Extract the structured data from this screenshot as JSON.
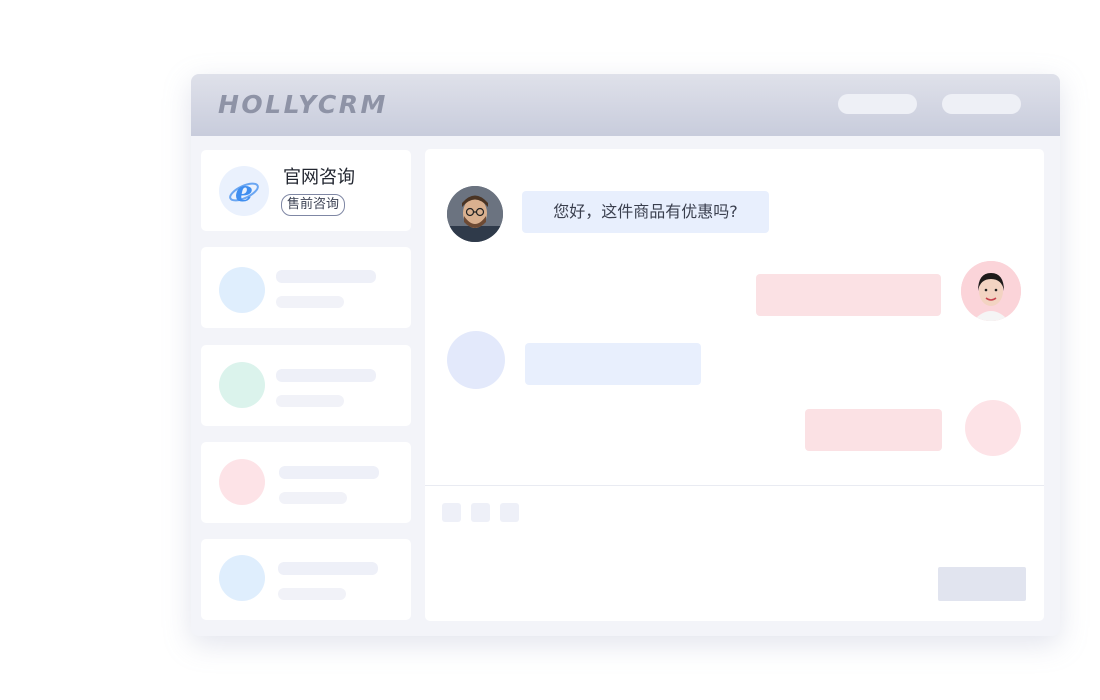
{
  "app": {
    "brand": "HOLLYCRM"
  },
  "sidebar": {
    "active_session": {
      "icon": "ie-browser-icon",
      "title": "官网咨询",
      "tag": "售前咨询"
    },
    "placeholder_accents": [
      "#dfeefd",
      "#dbf3ec",
      "#fde3e7",
      "#dfeefd"
    ]
  },
  "chat": {
    "incoming_message": "您好，这件商品有优惠吗?",
    "customer_avatar": "customer-avatar-male",
    "agent_avatar": "agent-avatar-female",
    "colors": {
      "incoming_bubble": "#e8effd",
      "outgoing_bubble": "#fbe1e4"
    }
  }
}
